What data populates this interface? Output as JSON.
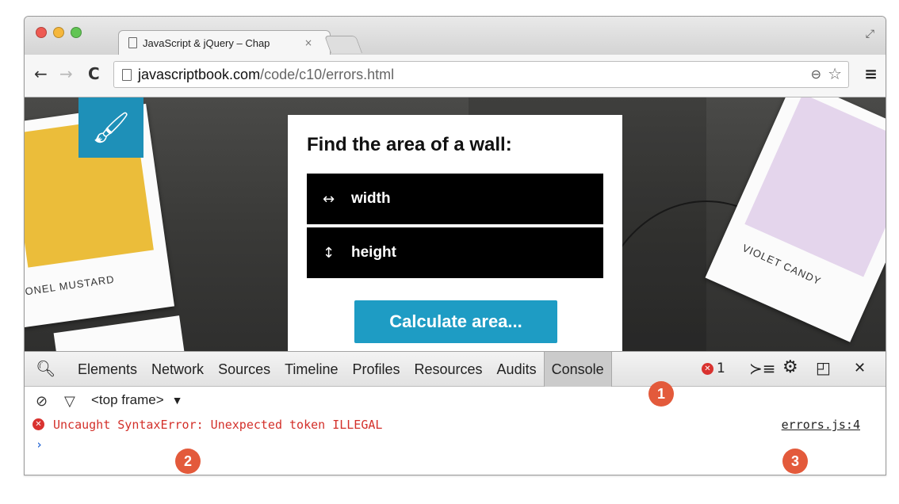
{
  "browser": {
    "tab": {
      "title": "JavaScript & jQuery – Chap",
      "close": "×"
    },
    "toolbar": {
      "back": "←",
      "forward": "→",
      "reload": "C",
      "url_host": "javascriptbook.com",
      "url_path": "/code/c10/errors.html",
      "zoom_icon": "magnifier-minus-icon",
      "star_icon": "star-icon",
      "menu_icon": "hamburger-menu-icon"
    },
    "controls": {
      "close_color": "#ee5a52",
      "minimize_color": "#f5b73b",
      "maximize_color": "#62c554"
    }
  },
  "page": {
    "swatch_left_label": "ONEL MUSTARD",
    "swatch_right_label": "VIOLET CANDY",
    "card": {
      "title": "Find the area of a wall:",
      "width_label": "width",
      "height_label": "height",
      "button_label": "Calculate area..."
    },
    "colors": {
      "brush_tile": "#1e90b8",
      "button": "#1e9cc4",
      "mustard": "#ebbd3a",
      "violet": "#e4d5ec"
    }
  },
  "devtools": {
    "tabs": [
      "Elements",
      "Network",
      "Sources",
      "Timeline",
      "Profiles",
      "Resources",
      "Audits",
      "Console"
    ],
    "active_tab": "Console",
    "error_count": "1",
    "frame_selector": "<top frame>",
    "frame_arrow": "▼",
    "console": {
      "error_message": "Uncaught SyntaxError: Unexpected token ILLEGAL",
      "error_source": "errors.js:4",
      "prompt": "›"
    }
  },
  "callouts": [
    "1",
    "2",
    "3"
  ]
}
